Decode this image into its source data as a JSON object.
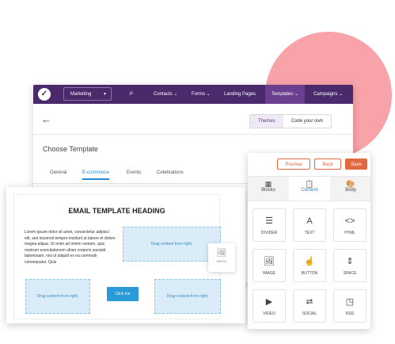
{
  "nav": {
    "logo_icon": "logo-mark",
    "marketing_label": "Marketing",
    "search_icon": "search-icon",
    "contacts": "Contacts ⌄",
    "forms": "Forms ⌄",
    "landing_pages": "Landing Pages",
    "templates": "Templates ⌄",
    "campaigns": "Campaigns ⌄"
  },
  "subbar": {
    "back_icon": "arrow-left-icon",
    "themes": "Themes",
    "code_your_own": "Code your own"
  },
  "page": {
    "title": "Choose Template",
    "tabs": [
      "General",
      "E-commerce",
      "Events",
      "Celebrations"
    ],
    "selected_tab": "E-commerce"
  },
  "editor": {
    "heading": "EMAIL TEMPLATE HEADING",
    "body": "Lorem ipsum dolor sit amet, consectetur adipisci elit, sed eiusmod tempor incidunt ut labore et dolore magna aliqua. Ut enim ad minim veniam, quis nostrum exercitationem ullam corporis suscipit laboriosam, nisi ut aliquid ex ea commodi consequatur. Quis",
    "drag_right": "Drag content from right.",
    "drag_left": "Drag content from right.",
    "drag_bottom_right": "Drag content from right.",
    "click_me": "Click me",
    "floating_image_label": "IMAGE"
  },
  "panel": {
    "preview": "Preview",
    "back": "Back",
    "save": "Save",
    "tabs": [
      "Blocks",
      "Content",
      "Body"
    ],
    "selected_tab": "Content",
    "tiles": [
      "DIVIDER",
      "TEXT",
      "HTML",
      "IMAGE",
      "BUTTON",
      "SPACE",
      "VIDEO",
      "SOCIAL",
      "RSS"
    ]
  },
  "colors": {
    "nav_bg": "#4b2a6c",
    "accent_blue": "#2a8bd1",
    "save_orange": "#e4683f",
    "blob_pink": "#f7a3a9"
  }
}
